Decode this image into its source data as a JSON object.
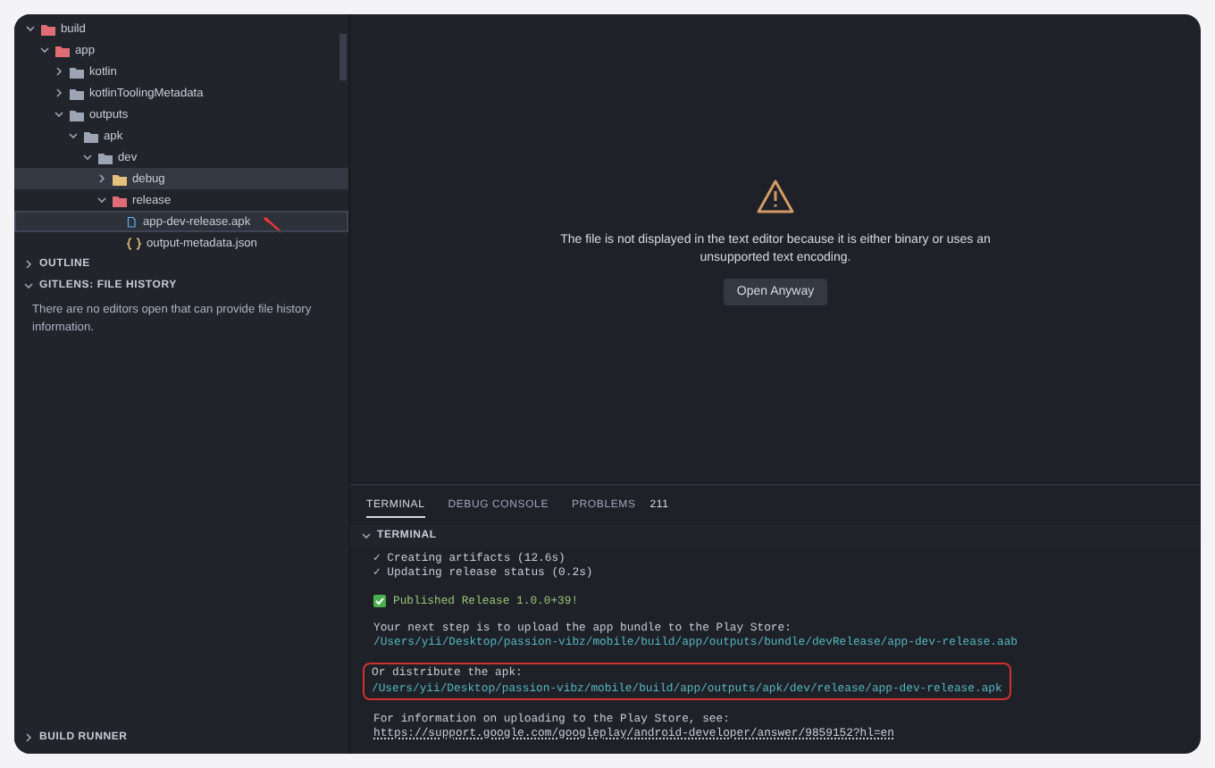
{
  "explorer": {
    "tree": [
      {
        "label": "build",
        "kind": "folder",
        "color": "#e06c75",
        "expanded": true,
        "selected": false,
        "children": [
          {
            "label": "app",
            "kind": "folder",
            "color": "#e06c75",
            "expanded": true,
            "selected": false,
            "children": [
              {
                "label": "kotlin",
                "kind": "folder",
                "color": "#9da5b4",
                "expanded": false,
                "selected": false
              },
              {
                "label": "kotlinToolingMetadata",
                "kind": "folder",
                "color": "#9da5b4",
                "expanded": false,
                "selected": false
              },
              {
                "label": "outputs",
                "kind": "folder",
                "color": "#9da5b4",
                "expanded": true,
                "selected": false,
                "children": [
                  {
                    "label": "apk",
                    "kind": "folder",
                    "color": "#9da5b4",
                    "expanded": true,
                    "selected": false,
                    "children": [
                      {
                        "label": "dev",
                        "kind": "folder",
                        "color": "#9da5b4",
                        "expanded": true,
                        "selected": false,
                        "children": [
                          {
                            "label": "debug",
                            "kind": "folder",
                            "color": "#e5c07b",
                            "expanded": false,
                            "selected": false,
                            "hovered": true
                          },
                          {
                            "label": "release",
                            "kind": "folder",
                            "color": "#e06c75",
                            "expanded": true,
                            "selected": false,
                            "children": [
                              {
                                "label": "app-dev-release.apk",
                                "kind": "file",
                                "color": "#61afef",
                                "selected": true,
                                "pointer": true
                              },
                              {
                                "label": "output-metadata.json",
                                "kind": "json",
                                "color": "#e5c07b",
                                "selected": false
                              }
                            ]
                          }
                        ]
                      }
                    ]
                  }
                ]
              }
            ]
          }
        ]
      }
    ]
  },
  "sections": [
    {
      "title": "OUTLINE",
      "expanded": false
    },
    {
      "title": "GITLENS: FILE HISTORY",
      "expanded": true,
      "message": "There are no editors open that can provide file history information."
    }
  ],
  "bottom_section": {
    "title": "BUILD RUNNER",
    "expanded": false
  },
  "editor": {
    "message": "The file is not displayed in the text editor because it is either binary or uses an unsupported text encoding.",
    "button": "Open Anyway"
  },
  "panel": {
    "tabs": [
      {
        "label": "TERMINAL",
        "selected": true
      },
      {
        "label": "DEBUG CONSOLE",
        "selected": false
      },
      {
        "label": "PROBLEMS",
        "selected": false,
        "badge": "211"
      }
    ],
    "header": {
      "title": "TERMINAL",
      "expanded": true
    },
    "blocks": [
      {
        "lines": [
          {
            "kind": "check",
            "text": "✓ Creating artifacts (12.6s)"
          },
          {
            "kind": "check",
            "text": "✓ Updating release status (0.2s)"
          }
        ]
      },
      {
        "lines": [
          {
            "kind": "success",
            "text": "Published Release 1.0.0+39!"
          }
        ]
      },
      {
        "lines": [
          {
            "kind": "plain",
            "text": "Your next step is to upload the app bundle to the Play Store:"
          },
          {
            "kind": "path",
            "text": "/Users/yii/Desktop/passion-vibz/mobile/build/app/outputs/bundle/devRelease/app-dev-release.aab"
          }
        ]
      },
      {
        "outlined": true,
        "lines": [
          {
            "kind": "plain",
            "text": "Or distribute the apk:"
          },
          {
            "kind": "path",
            "text": "/Users/yii/Desktop/passion-vibz/mobile/build/app/outputs/apk/dev/release/app-dev-release.apk"
          }
        ]
      },
      {
        "lines": [
          {
            "kind": "plain",
            "text": "For information on uploading to the Play Store, see:"
          },
          {
            "kind": "link",
            "text": "https://support.google.com/googleplay/android-developer/answer/9859152?hl=en"
          }
        ]
      }
    ]
  }
}
